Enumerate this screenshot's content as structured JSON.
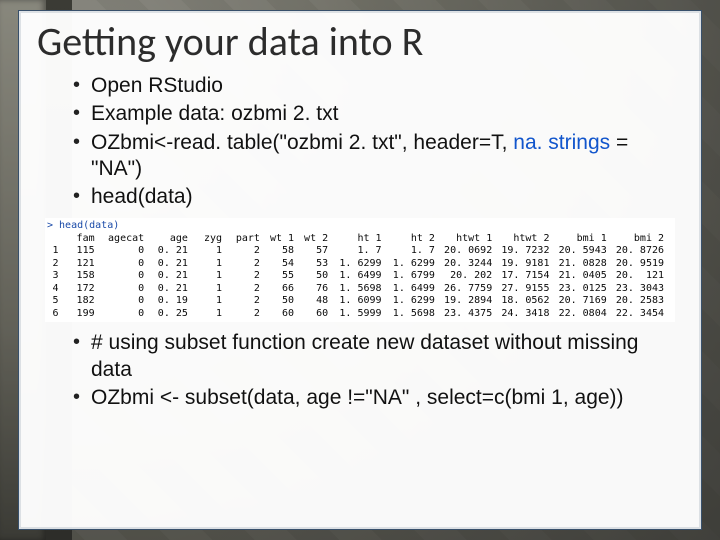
{
  "title": "Getting your data into R",
  "bullets_top": [
    "Open RStudio",
    "Example data: ozbmi 2. txt",
    "OZbmi<-read. table(\"ozbmi 2. txt\", header=T, na. strings = \"NA\")",
    "head(data)"
  ],
  "bullets_bottom": [
    "# using subset function create new dataset without missing data",
    "OZbmi <- subset(data, age !=\"NA\" , select=c(bmi 1, age))"
  ],
  "link_span": "na. strings",
  "console": {
    "prompt": "> head(data)",
    "headers": [
      "",
      "fam",
      "agecat",
      "age",
      "zyg",
      "part",
      "wt 1",
      "wt 2",
      "ht 1",
      "ht 2",
      "htwt 1",
      "htwt 2",
      "bmi 1",
      "bmi 2"
    ],
    "rows": [
      [
        "1",
        "115",
        "0",
        "0. 21",
        "1",
        "2",
        "58",
        "57",
        "1. 7",
        "1. 7",
        "20. 0692",
        "19. 7232",
        "20. 5943",
        "20. 8726"
      ],
      [
        "2",
        "121",
        "0",
        "0. 21",
        "1",
        "2",
        "54",
        "53",
        "1. 6299",
        "1. 6299",
        "20. 3244",
        "19. 9181",
        "21. 0828",
        "20. 9519"
      ],
      [
        "3",
        "158",
        "0",
        "0. 21",
        "1",
        "2",
        "55",
        "50",
        "1. 6499",
        "1. 6799",
        "20. 202",
        "17. 7154",
        "21. 0405",
        "20.  121"
      ],
      [
        "4",
        "172",
        "0",
        "0. 21",
        "1",
        "2",
        "66",
        "76",
        "1. 5698",
        "1. 6499",
        "26. 7759",
        "27. 9155",
        "23. 0125",
        "23. 3043"
      ],
      [
        "5",
        "182",
        "0",
        "0. 19",
        "1",
        "2",
        "50",
        "48",
        "1. 6099",
        "1. 6299",
        "19. 2894",
        "18. 0562",
        "20. 7169",
        "20. 2583"
      ],
      [
        "6",
        "199",
        "0",
        "0. 25",
        "1",
        "2",
        "60",
        "60",
        "1. 5999",
        "1. 5698",
        "23. 4375",
        "24. 3418",
        "22. 0804",
        "22. 3454"
      ]
    ]
  },
  "chart_data": {
    "type": "table",
    "title": "head(data)",
    "columns": [
      "fam",
      "agecat",
      "age",
      "zyg",
      "part",
      "wt1",
      "wt2",
      "ht1",
      "ht2",
      "htwt1",
      "htwt2",
      "bmi1",
      "bmi2"
    ],
    "rows": [
      {
        "fam": 115,
        "agecat": 0,
        "age": 0.21,
        "zyg": 1,
        "part": 2,
        "wt1": 58,
        "wt2": 57,
        "ht1": 1.7,
        "ht2": 1.7,
        "htwt1": 20.0692,
        "htwt2": 19.7232,
        "bmi1": 20.5943,
        "bmi2": 20.8726
      },
      {
        "fam": 121,
        "agecat": 0,
        "age": 0.21,
        "zyg": 1,
        "part": 2,
        "wt1": 54,
        "wt2": 53,
        "ht1": 1.6299,
        "ht2": 1.6299,
        "htwt1": 20.3244,
        "htwt2": 19.9181,
        "bmi1": 21.0828,
        "bmi2": 20.9519
      },
      {
        "fam": 158,
        "agecat": 0,
        "age": 0.21,
        "zyg": 1,
        "part": 2,
        "wt1": 55,
        "wt2": 50,
        "ht1": 1.6499,
        "ht2": 1.6799,
        "htwt1": 20.202,
        "htwt2": 17.7154,
        "bmi1": 21.0405,
        "bmi2": 20.121
      },
      {
        "fam": 172,
        "agecat": 0,
        "age": 0.21,
        "zyg": 1,
        "part": 2,
        "wt1": 66,
        "wt2": 76,
        "ht1": 1.5698,
        "ht2": 1.6499,
        "htwt1": 26.7759,
        "htwt2": 27.9155,
        "bmi1": 23.0125,
        "bmi2": 23.3043
      },
      {
        "fam": 182,
        "agecat": 0,
        "age": 0.19,
        "zyg": 1,
        "part": 2,
        "wt1": 50,
        "wt2": 48,
        "ht1": 1.6099,
        "ht2": 1.6299,
        "htwt1": 19.2894,
        "htwt2": 18.0562,
        "bmi1": 20.7169,
        "bmi2": 20.2583
      },
      {
        "fam": 199,
        "agecat": 0,
        "age": 0.25,
        "zyg": 1,
        "part": 2,
        "wt1": 60,
        "wt2": 60,
        "ht1": 1.5999,
        "ht2": 1.5698,
        "htwt1": 23.4375,
        "htwt2": 24.3418,
        "bmi1": 22.0804,
        "bmi2": 22.3454
      }
    ]
  }
}
